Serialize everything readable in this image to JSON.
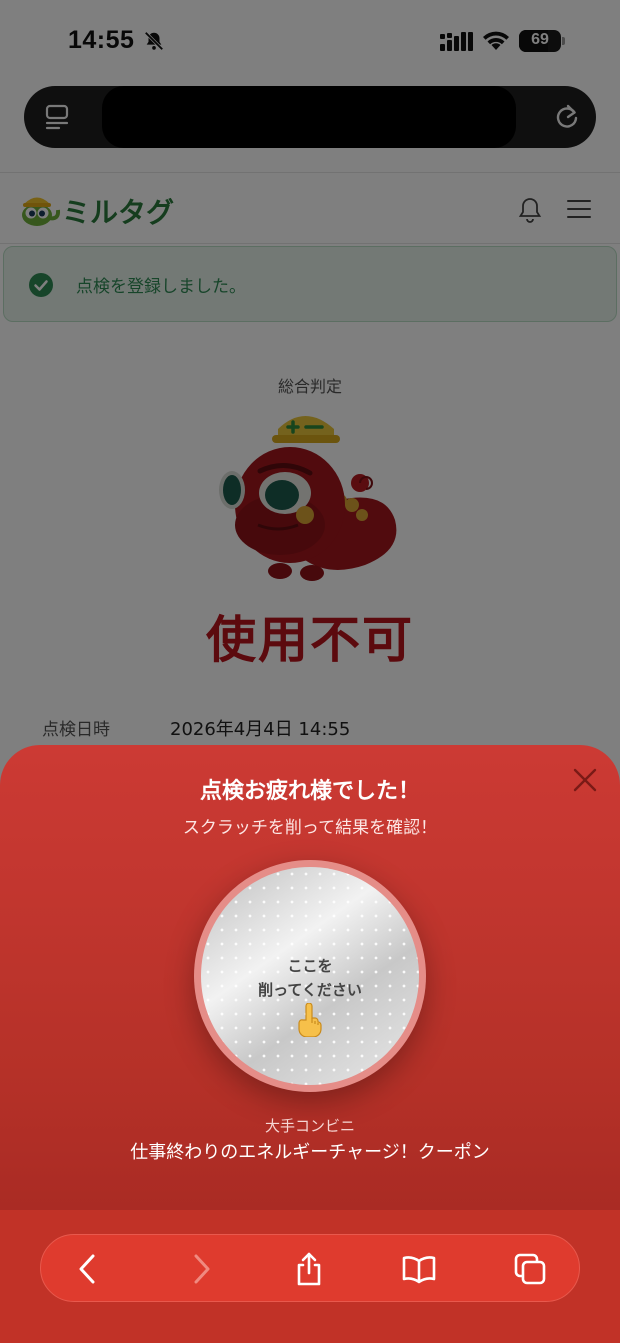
{
  "status_bar": {
    "time": "14:55",
    "battery": "69",
    "battery_level": 0.69
  },
  "site": {
    "logo_text": "ミルタグ"
  },
  "toast": {
    "message": "点検を登録しました。"
  },
  "result": {
    "label": "総合判定",
    "value": "使用不可",
    "date_label": "点検日時",
    "date_value": "2026年4月4日 14:55"
  },
  "modal": {
    "title": "点検お疲れ様でした！",
    "subtitle": "スクラッチを削って結果を確認！",
    "scratch_line1": "ここを",
    "scratch_line2": "削ってください",
    "coupon_brand": "大手コンビニ",
    "coupon_name": "仕事終わりのエネルギーチャージ！クーポン"
  },
  "colors": {
    "sheet": "#cc3a34",
    "verdict": "#b8141c",
    "toast_text": "#2e8a55",
    "brand_green": "#2e8a3a"
  },
  "icons": [
    "bell-off-icon",
    "signal-icon",
    "wifi-icon",
    "battery-icon",
    "tabs-icon",
    "reload-icon",
    "bell-icon",
    "menu-icon",
    "check-icon",
    "close-icon",
    "finger-pointer-icon",
    "back-icon",
    "forward-icon",
    "share-icon",
    "bookmarks-icon",
    "tabs-overview-icon"
  ]
}
